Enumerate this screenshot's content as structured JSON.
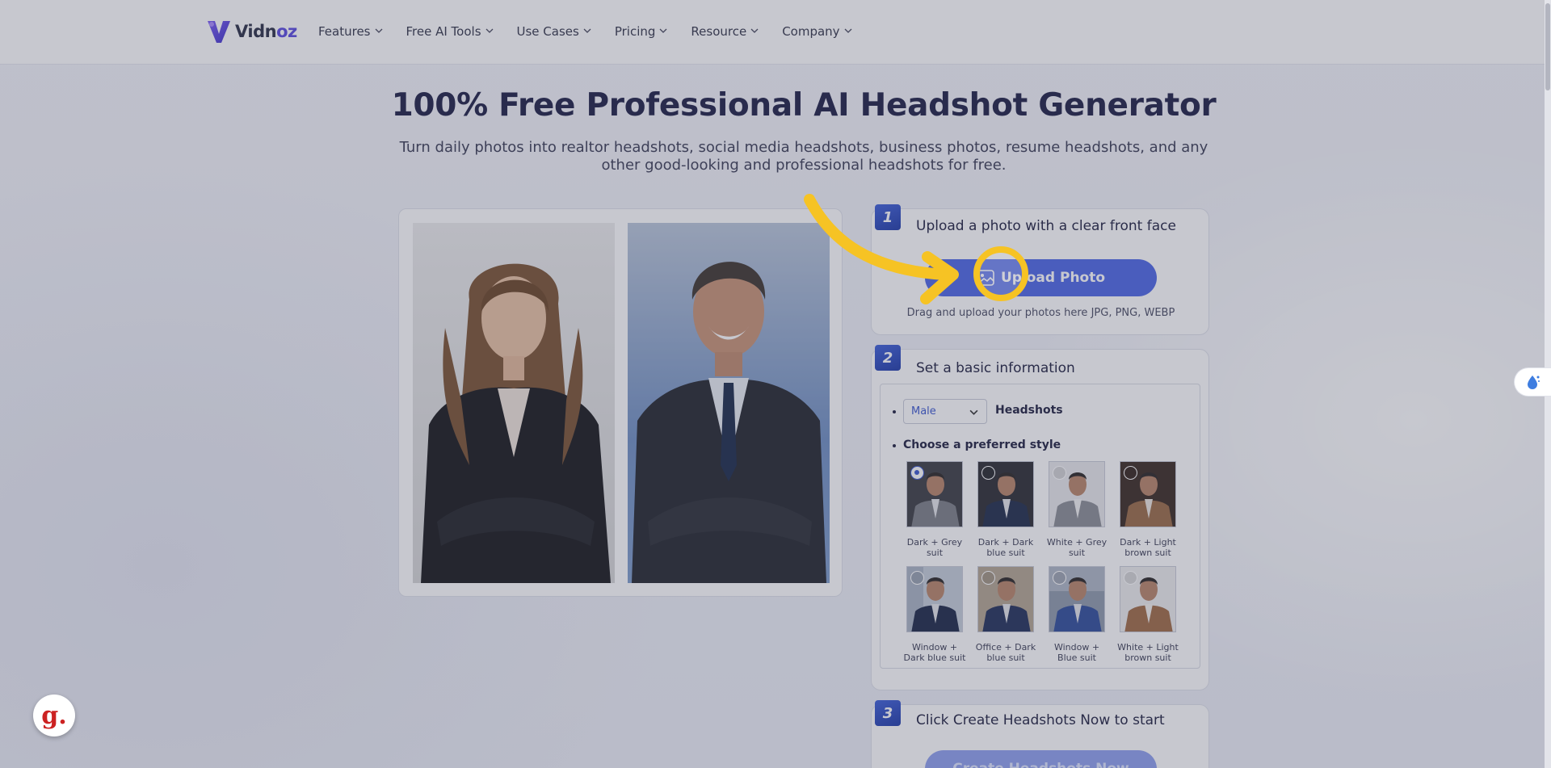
{
  "header": {
    "logo_text_main": "Vidn",
    "logo_text_accent": "oz",
    "nav": [
      {
        "label": "Features"
      },
      {
        "label": "Free AI Tools"
      },
      {
        "label": "Use Cases"
      },
      {
        "label": "Pricing"
      },
      {
        "label": "Resource"
      },
      {
        "label": "Company"
      }
    ]
  },
  "hero": {
    "title": "100% Free Professional AI Headshot Generator",
    "subtitle": "Turn daily photos into realtor headshots, social media headshots, business photos, resume headshots, and any other good-looking and professional headshots for free."
  },
  "steps": {
    "step1": {
      "number": "1",
      "title": "Upload a photo with a clear front face",
      "button_label": "Upload Photo",
      "hint": "Drag and upload your photos here JPG, PNG, WEBP"
    },
    "step2": {
      "number": "2",
      "title": "Set a basic information",
      "gender_selected": "Male",
      "headshots_label": "Headshots",
      "style_label": "Choose a preferred style",
      "styles": [
        {
          "caption": "Dark + Grey suit",
          "selected": true
        },
        {
          "caption": "Dark + Dark blue suit",
          "selected": false
        },
        {
          "caption": "White + Grey suit",
          "selected": false
        },
        {
          "caption": "Dark + Light brown suit",
          "selected": false
        },
        {
          "caption": "Window + Dark blue suit",
          "selected": false
        },
        {
          "caption": "Office + Dark blue suit",
          "selected": false
        },
        {
          "caption": "Window + Blue suit",
          "selected": false
        },
        {
          "caption": "White + Light brown suit",
          "selected": false
        }
      ]
    },
    "step3": {
      "number": "3",
      "title": "Click Create Headshots Now to start",
      "button_label": "Create Headshots Now"
    }
  },
  "widgets": {
    "g_button_label": "g."
  },
  "colors": {
    "primary": "#4c66e6",
    "step_badge": "#2a48c0",
    "annotation_yellow": "#f6c324",
    "logo_accent": "#5a49e0"
  },
  "icons": {
    "nav_chevron": "chevron-down-icon",
    "upload_icon": "image-icon",
    "side_widget": "water-drop-icon",
    "annotation_arrow": "arrow-icon"
  }
}
